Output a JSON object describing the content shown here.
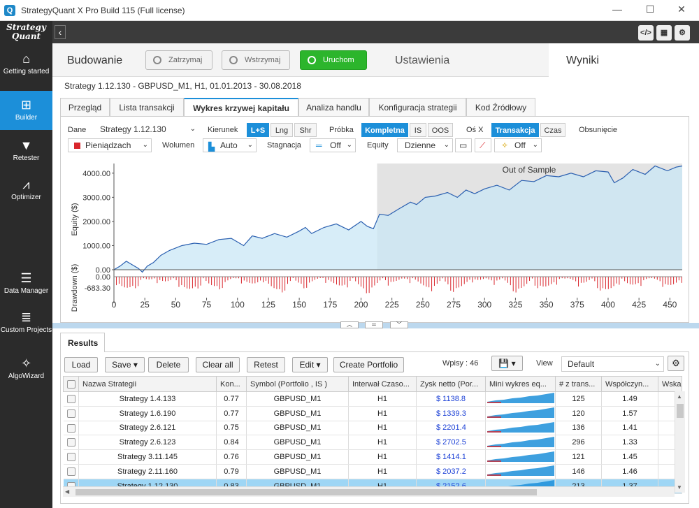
{
  "window": {
    "title": "StrategyQuant X Pro Build 115 (Full license)",
    "minimize": "—",
    "maximize": "☐",
    "close": "✕"
  },
  "sidebar": {
    "logo_line1": "Strategy",
    "logo_line2": "Quant",
    "items": [
      {
        "label": "Getting started",
        "icon": "home-icon"
      },
      {
        "label": "Builder",
        "icon": "plus-icon"
      },
      {
        "label": "Retester",
        "icon": "filter-icon"
      },
      {
        "label": "Optimizer",
        "icon": "chart-icon"
      },
      {
        "label": "Data Manager",
        "icon": "database-icon"
      },
      {
        "label": "Custom Projects",
        "icon": "list-icon"
      },
      {
        "label": "AlgoWizard",
        "icon": "wand-icon"
      }
    ]
  },
  "topbar": {
    "back": "‹",
    "btn_code": "</>",
    "btn_grid": "▦",
    "btn_gear": "⚙"
  },
  "header": {
    "title": "Budowanie",
    "stop": "Zatrzymaj",
    "pause": "Wstrzymaj",
    "start": "Uruchom",
    "settings": "Ustawienia",
    "results": "Wyniki"
  },
  "subtitle": "Strategy 1.12.130 - GBPUSD_M1, H1, 01.01.2013 - 30.08.2018",
  "tabs": [
    "Przegląd",
    "Lista transakcji",
    "Wykres krzywej kapitału",
    "Analiza handlu",
    "Konfiguracja strategii",
    "Kod Źródłowy"
  ],
  "controls": {
    "dane_label": "Dane",
    "dane_value": "Strategy 1.12.130",
    "kierunek_label": "Kierunek",
    "kierunek_options": [
      "L+S",
      "Lng",
      "Shr"
    ],
    "probka_label": "Próbka",
    "probka_options": [
      "Kompletna",
      "IS",
      "OOS"
    ],
    "osx_label": "Oś X",
    "osx_options": [
      "Transakcja",
      "Czas"
    ],
    "obsuniecie_label": "Obsunięcie",
    "units_value": "Pieniądzach",
    "wolumen_label": "Wolumen",
    "wolumen_value": "Auto",
    "stagnacja_label": "Stagnacja",
    "stagnacja_value": "Off",
    "equity_label": "Equity",
    "equity_value": "Dzienne",
    "last_value": "Off"
  },
  "chart_data": {
    "type": "area",
    "oos_label": "Out of Sample",
    "ylabel": "Equity ($)",
    "ylabel2": "Drawdown ($)",
    "yticks": [
      "4000.00",
      "3000.00",
      "2000.00",
      "1000.00",
      "0.00"
    ],
    "dd_ticks": [
      "0.00",
      "-683.30"
    ],
    "xticks": [
      "0",
      "25",
      "50",
      "75",
      "100",
      "125",
      "150",
      "175",
      "200",
      "225",
      "250",
      "275",
      "300",
      "325",
      "350",
      "375",
      "400",
      "425",
      "450"
    ],
    "oos_start": 213,
    "x_max": 460,
    "y_max": 4400,
    "dd_min": -683.3,
    "equity": [
      [
        0,
        0
      ],
      [
        5,
        150
      ],
      [
        10,
        350
      ],
      [
        15,
        200
      ],
      [
        20,
        50
      ],
      [
        23,
        -100
      ],
      [
        27,
        150
      ],
      [
        32,
        300
      ],
      [
        38,
        600
      ],
      [
        45,
        800
      ],
      [
        55,
        1000
      ],
      [
        65,
        1100
      ],
      [
        75,
        1050
      ],
      [
        85,
        1250
      ],
      [
        95,
        1300
      ],
      [
        105,
        1000
      ],
      [
        112,
        1400
      ],
      [
        120,
        1300
      ],
      [
        130,
        1500
      ],
      [
        140,
        1350
      ],
      [
        150,
        1600
      ],
      [
        155,
        1750
      ],
      [
        160,
        1500
      ],
      [
        170,
        1750
      ],
      [
        180,
        1900
      ],
      [
        190,
        1650
      ],
      [
        200,
        2000
      ],
      [
        205,
        1800
      ],
      [
        210,
        1700
      ],
      [
        215,
        2300
      ],
      [
        222,
        2250
      ],
      [
        230,
        2500
      ],
      [
        240,
        2800
      ],
      [
        245,
        2700
      ],
      [
        252,
        3000
      ],
      [
        260,
        3050
      ],
      [
        270,
        3200
      ],
      [
        278,
        3000
      ],
      [
        285,
        3300
      ],
      [
        292,
        3150
      ],
      [
        300,
        3350
      ],
      [
        310,
        3500
      ],
      [
        320,
        3300
      ],
      [
        330,
        3700
      ],
      [
        340,
        3650
      ],
      [
        350,
        3900
      ],
      [
        360,
        3850
      ],
      [
        370,
        4000
      ],
      [
        380,
        3850
      ],
      [
        390,
        4100
      ],
      [
        400,
        4050
      ],
      [
        405,
        3600
      ],
      [
        412,
        3800
      ],
      [
        420,
        4150
      ],
      [
        430,
        3950
      ],
      [
        438,
        4300
      ],
      [
        448,
        4100
      ],
      [
        455,
        4250
      ],
      [
        460,
        4300
      ]
    ]
  },
  "splitter": {
    "up": "︿",
    "mid": "═",
    "down": "﹀"
  },
  "results": {
    "tab": "Results",
    "load": "Load",
    "save": "Save ▾",
    "delete": "Delete",
    "clear_all": "Clear all",
    "retest": "Retest",
    "edit": "Edit ▾",
    "create_portfolio": "Create Portfolio",
    "wpisy": "Wpisy : 46",
    "view_label": "View",
    "view_value": "Default",
    "save_icon": "💾 ▾",
    "columns": [
      "Nazwa Strategii",
      "Kon...",
      "Symbol (Portfolio , IS )",
      "Interwał Czaso...",
      "Zysk netto (Por...",
      "Mini wykres eq...",
      "# z trans...",
      "Współczyn...",
      "Wska"
    ],
    "rows": [
      {
        "name": "Strategy 1.4.133",
        "kon": "0.77",
        "symbol": "GBPUSD_M1",
        "tf": "H1",
        "zysk": "$ 1138.8",
        "trades": "125",
        "wsp": "1.49"
      },
      {
        "name": "Strategy 1.6.190",
        "kon": "0.77",
        "symbol": "GBPUSD_M1",
        "tf": "H1",
        "zysk": "$ 1339.3",
        "trades": "120",
        "wsp": "1.57"
      },
      {
        "name": "Strategy 2.6.121",
        "kon": "0.75",
        "symbol": "GBPUSD_M1",
        "tf": "H1",
        "zysk": "$ 2201.4",
        "trades": "136",
        "wsp": "1.41"
      },
      {
        "name": "Strategy 2.6.123",
        "kon": "0.84",
        "symbol": "GBPUSD_M1",
        "tf": "H1",
        "zysk": "$ 2702.5",
        "trades": "296",
        "wsp": "1.33"
      },
      {
        "name": "Strategy 3.11.145",
        "kon": "0.76",
        "symbol": "GBPUSD_M1",
        "tf": "H1",
        "zysk": "$ 1414.1",
        "trades": "121",
        "wsp": "1.45"
      },
      {
        "name": "Strategy 2.11.160",
        "kon": "0.79",
        "symbol": "GBPUSD_M1",
        "tf": "H1",
        "zysk": "$ 2037.2",
        "trades": "146",
        "wsp": "1.46"
      },
      {
        "name": "Strategy 1.12.130",
        "kon": "0.83",
        "symbol": "GBPUSD_M1",
        "tf": "H1",
        "zysk": "$ 2152.6",
        "trades": "213",
        "wsp": "1.37"
      }
    ]
  },
  "colors": {
    "accent": "#1c8fd9",
    "green": "#2cb52c",
    "sidebar": "#2b2b2b",
    "equity_fill": "#d6eef9",
    "oos_fill": "#e3e3e3",
    "dd": "#d9262c"
  }
}
